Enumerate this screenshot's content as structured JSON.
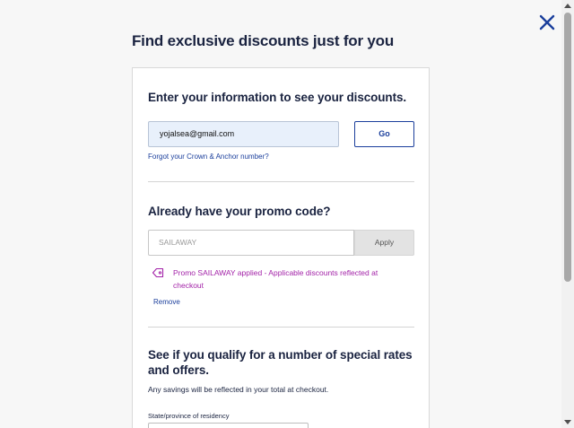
{
  "modal": {
    "title": "Find exclusive discounts just for you",
    "close_icon": "close-icon"
  },
  "info_section": {
    "heading": "Enter your information to see your discounts.",
    "email_value": "yojalsea@gmail.com",
    "go_label": "Go",
    "forgot_link": "Forgot your Crown & Anchor number?"
  },
  "promo_section": {
    "heading": "Already have your promo code?",
    "placeholder": "SAILAWAY",
    "apply_label": "Apply",
    "applied_message": "Promo SAILAWAY applied - Applicable discounts reflected at checkout",
    "remove_label": "Remove",
    "icon": "tag-icon"
  },
  "qualify_section": {
    "heading": "See if you qualify for a number of special rates and offers.",
    "subtext": "Any savings will be reflected in your total at checkout.",
    "state_label": "State/province of residency",
    "state_value": ""
  },
  "colors": {
    "brand_blue": "#1b3f9c",
    "promo_purple": "#a323a8",
    "heading": "#1a2340"
  }
}
